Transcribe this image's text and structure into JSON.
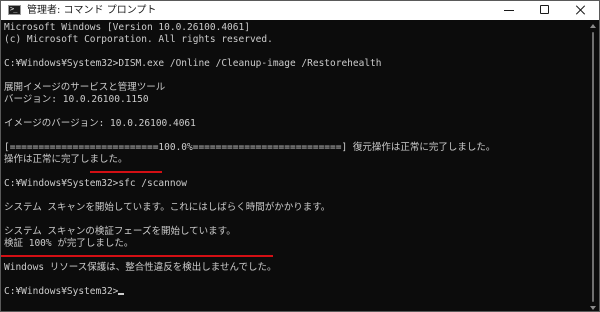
{
  "window": {
    "title": "管理者: コマンド プロンプト",
    "icon": "command-prompt-icon",
    "icon_glyph": ">_"
  },
  "console": {
    "lines": [
      "Microsoft Windows [Version 10.0.26100.4061]",
      "(c) Microsoft Corporation. All rights reserved.",
      "",
      "C:¥Windows¥System32>DISM.exe /Online /Cleanup-image /Restorehealth",
      "",
      "展開イメージのサービスと管理ツール",
      "バージョン: 10.0.26100.1150",
      "",
      "イメージのバージョン: 10.0.26100.4061",
      "",
      "[==========================100.0%==========================] 復元操作は正常に完了しました。",
      "操作は正常に完了しました。",
      "",
      "C:¥Windows¥System32>sfc /scannow",
      "",
      "システム スキャンを開始しています。これにはしばらく時間がかかります。",
      "",
      "システム スキャンの検証フェーズを開始しています。",
      "検証 100% が完了しました。",
      "",
      "Windows リソース保護は、整合性違反を検出しませんでした。",
      "",
      "C:¥Windows¥System32>"
    ]
  },
  "colors": {
    "console_background": "#0c0c0c",
    "console_text": "#cccccc",
    "titlebar_background": "#ffffff",
    "annotation_underline": "#d30f14"
  }
}
